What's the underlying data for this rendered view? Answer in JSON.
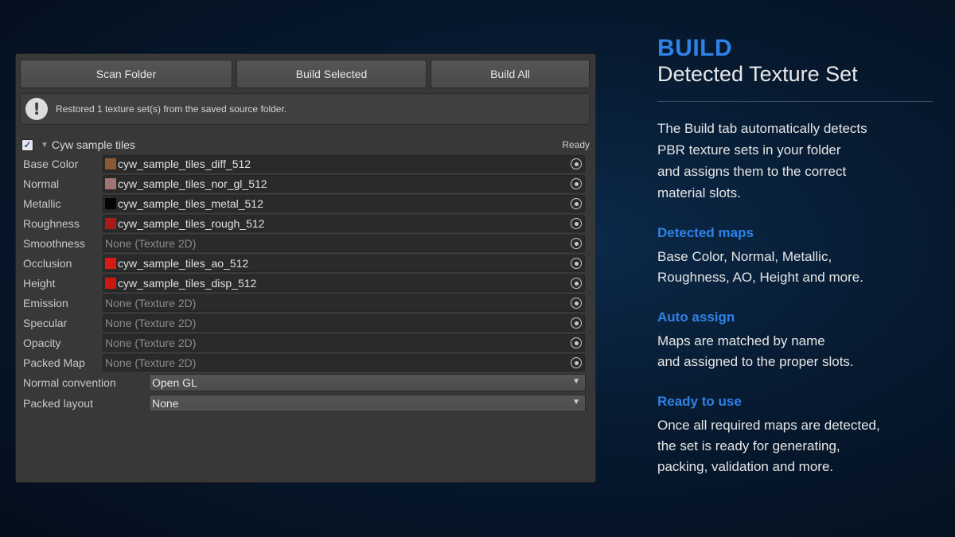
{
  "toolbar": {
    "scan_label": "Scan Folder",
    "build_selected_label": "Build Selected",
    "build_all_label": "Build All"
  },
  "help": {
    "icon": "exclamation-icon",
    "message": "Restored 1 texture set(s) from the saved source folder."
  },
  "texture_set": {
    "checked": true,
    "checkmark": "✓",
    "name": "Cyw sample tiles",
    "status": "Ready"
  },
  "slots": [
    {
      "label": "Base Color",
      "value": "cyw_sample_tiles_diff_512",
      "swatch": "#8b5a35"
    },
    {
      "label": "Normal",
      "value": "cyw_sample_tiles_nor_gl_512",
      "swatch": "#a27373"
    },
    {
      "label": "Metallic",
      "value": "cyw_sample_tiles_metal_512",
      "swatch": "#050505"
    },
    {
      "label": "Roughness",
      "value": "cyw_sample_tiles_rough_512",
      "swatch": "#a81c17"
    },
    {
      "label": "Smoothness",
      "value": "None (Texture 2D)",
      "swatch": null
    },
    {
      "label": "Occlusion",
      "value": "cyw_sample_tiles_ao_512",
      "swatch": "#d81a14"
    },
    {
      "label": "Height",
      "value": "cyw_sample_tiles_disp_512",
      "swatch": "#cc1810"
    },
    {
      "label": "Emission",
      "value": "None (Texture 2D)",
      "swatch": null
    },
    {
      "label": "Specular",
      "value": "None (Texture 2D)",
      "swatch": null
    },
    {
      "label": "Opacity",
      "value": "None (Texture 2D)",
      "swatch": null
    },
    {
      "label": "Packed Map",
      "value": "None (Texture 2D)",
      "swatch": null
    }
  ],
  "options": {
    "normal_convention_label": "Normal convention",
    "normal_convention_value": "Open GL",
    "packed_layout_label": "Packed layout",
    "packed_layout_value": "None"
  },
  "info": {
    "kicker": "BUILD",
    "headline": "Detected Texture Set",
    "lead": "The Build tab automatically detects\nPBR texture sets in your folder\nand assigns them to the correct\nmaterial slots.",
    "sections": [
      {
        "title": "Detected maps",
        "body": "Base Color, Normal, Metallic,\nRoughness, AO, Height and more."
      },
      {
        "title": "Auto assign",
        "body": "Maps are matched by name\nand assigned to the proper slots."
      },
      {
        "title": "Ready to use",
        "body": "Once all required maps are detected,\nthe set is ready for generating,\npacking, validation and more."
      }
    ]
  },
  "colors": {
    "accent": "#2f82e6",
    "panel": "#383838",
    "background": "#071a30"
  }
}
